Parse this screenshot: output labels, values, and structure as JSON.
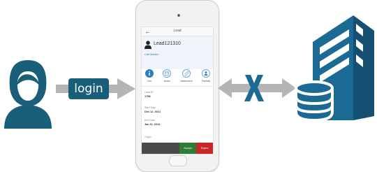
{
  "login": {
    "label": "login"
  },
  "app": {
    "title": "Lead",
    "lead_name": "Lead121310",
    "call_link": "Call Martin  !",
    "tabs": [
      {
        "label": "Info",
        "icon": "info-icon"
      },
      {
        "label": "Notes",
        "icon": "calendar-icon"
      },
      {
        "label": "Attachment",
        "icon": "paperclip-icon"
      },
      {
        "label": "Partially",
        "icon": "person-icon"
      }
    ],
    "fields": [
      {
        "label": "Lead ID",
        "value": "1798"
      },
      {
        "label": "Start Date",
        "value": "Dec 12, 2013"
      },
      {
        "label": "End Date",
        "value": "Jan 11, 2014"
      },
      {
        "label": "Origin",
        "value": ""
      }
    ],
    "accept_label": "Accept",
    "reject_label": "Reject"
  },
  "colors": {
    "brand": "#1a5f7a",
    "arrow_gray": "#b5b5b5",
    "block_x": "#1a6a93",
    "accept": "#2e7d32",
    "reject": "#c62828"
  }
}
